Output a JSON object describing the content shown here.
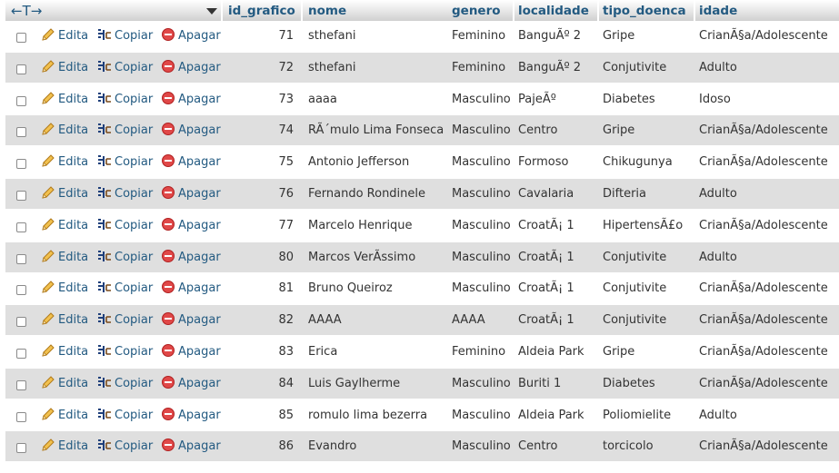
{
  "header": {
    "sort_arrows": "←T→",
    "columns": [
      "id_grafico",
      "nome",
      "genero",
      "localidade",
      "tipo_doenca",
      "idade"
    ]
  },
  "actions": {
    "edit_label": "Edita",
    "copy_label": "Copiar",
    "delete_label": "Apagar"
  },
  "rows": [
    {
      "id": "71",
      "nome": "sthefani",
      "genero": "Feminino",
      "localidade": "BanguÃº 2",
      "tipo_doenca": "Gripe",
      "idade": "CrianÃ§a/Adolescente"
    },
    {
      "id": "72",
      "nome": "sthefani",
      "genero": "Feminino",
      "localidade": "BanguÃº 2",
      "tipo_doenca": "Conjutivite",
      "idade": "Adulto"
    },
    {
      "id": "73",
      "nome": "aaaa",
      "genero": "Masculino",
      "localidade": "PajeÃº",
      "tipo_doenca": "Diabetes",
      "idade": "Idoso"
    },
    {
      "id": "74",
      "nome": "RÃ´mulo Lima Fonseca",
      "genero": "Masculino",
      "localidade": "Centro",
      "tipo_doenca": "Gripe",
      "idade": "CrianÃ§a/Adolescente"
    },
    {
      "id": "75",
      "nome": "Antonio Jefferson",
      "genero": "Masculino",
      "localidade": "Formoso",
      "tipo_doenca": "Chikugunya",
      "idade": "CrianÃ§a/Adolescente"
    },
    {
      "id": "76",
      "nome": "Fernando Rondinele",
      "genero": "Masculino",
      "localidade": "Cavalaria",
      "tipo_doenca": "Difteria",
      "idade": "Adulto"
    },
    {
      "id": "77",
      "nome": "Marcelo Henrique",
      "genero": "Masculino",
      "localidade": "CroatÃ¡ 1",
      "tipo_doenca": "HipertensÃ£o",
      "idade": "CrianÃ§a/Adolescente"
    },
    {
      "id": "80",
      "nome": "Marcos VerÃssimo",
      "genero": "Masculino",
      "localidade": "CroatÃ¡ 1",
      "tipo_doenca": "Conjutivite",
      "idade": "Adulto"
    },
    {
      "id": "81",
      "nome": "Bruno Queiroz",
      "genero": "Masculino",
      "localidade": "CroatÃ¡ 1",
      "tipo_doenca": "Conjutivite",
      "idade": "CrianÃ§a/Adolescente"
    },
    {
      "id": "82",
      "nome": "AAAA",
      "genero": "AAAA",
      "localidade": "CroatÃ¡ 1",
      "tipo_doenca": "Conjutivite",
      "idade": "CrianÃ§a/Adolescente"
    },
    {
      "id": "83",
      "nome": "Erica",
      "genero": "Feminino",
      "localidade": "Aldeia Park",
      "tipo_doenca": "Gripe",
      "idade": "CrianÃ§a/Adolescente"
    },
    {
      "id": "84",
      "nome": "Luis Gaylherme",
      "genero": "Masculino",
      "localidade": "Buriti 1",
      "tipo_doenca": "Diabetes",
      "idade": "CrianÃ§a/Adolescente"
    },
    {
      "id": "85",
      "nome": "romulo lima bezerra",
      "genero": "Masculino",
      "localidade": "Aldeia Park",
      "tipo_doenca": "Poliomielite",
      "idade": "Adulto"
    },
    {
      "id": "86",
      "nome": "Evandro",
      "genero": "Masculino",
      "localidade": "Centro",
      "tipo_doenca": "torcicolo",
      "idade": "CrianÃ§a/Adolescente"
    }
  ],
  "colors": {
    "link": "#235a81",
    "row_alt": "#dfdfdf",
    "delete_icon": "#d64545",
    "edit_icon": "#e0a020"
  },
  "icons": {
    "edit": "pencil-icon",
    "copy": "copy-icon",
    "delete": "delete-icon"
  }
}
